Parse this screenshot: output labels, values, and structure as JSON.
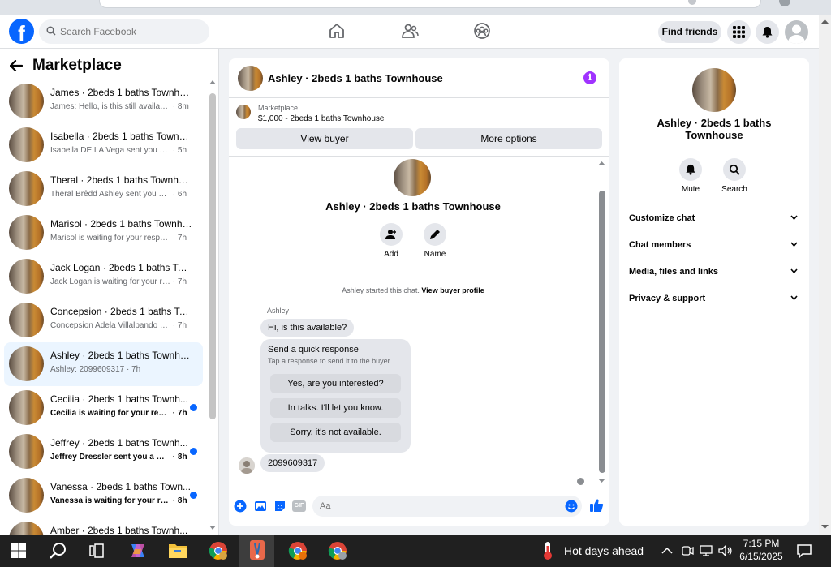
{
  "topbar": {
    "logo": "f",
    "search_placeholder": "Search Facebook",
    "find_friends": "Find friends"
  },
  "sidebar": {
    "title": "Marketplace",
    "conversations": [
      {
        "name": "James · 2beds 1 baths Townhouse",
        "preview": "James: Hello, is this still available?",
        "time": "· 8m",
        "unread": false,
        "active": false
      },
      {
        "name": "Isabella · 2beds 1 baths Townho...",
        "preview": "Isabella DE LA Vega sent you a me...",
        "time": "· 5h",
        "unread": false,
        "active": false
      },
      {
        "name": "Theral · 2beds 1 baths Townhouse",
        "preview": "Theral Brêdd Ashley sent you a me...",
        "time": "· 6h",
        "unread": false,
        "active": false
      },
      {
        "name": "Marisol · 2beds 1 baths Townho...",
        "preview": "Marisol is waiting for your respon...",
        "time": "· 7h",
        "unread": false,
        "active": false
      },
      {
        "name": "Jack Logan · 2beds 1 baths Tow...",
        "preview": "Jack Logan is waiting for your resp...",
        "time": "· 7h",
        "unread": false,
        "active": false
      },
      {
        "name": "Concepsion · 2beds 1 baths Tow...",
        "preview": "Concepsion Adela Villalpando sent...",
        "time": "· 7h",
        "unread": false,
        "active": false
      },
      {
        "name": "Ashley · 2beds 1 baths Townhou...",
        "preview": "Ashley: 2099609317",
        "time": "· 7h",
        "unread": false,
        "active": true
      },
      {
        "name": "Cecilia · 2beds 1 baths Townh...",
        "preview": "Cecilia is waiting for your resp...",
        "time": "· 7h",
        "unread": true,
        "active": false
      },
      {
        "name": "Jeffrey · 2beds 1 baths Townh...",
        "preview": "Jeffrey Dressler sent you a mes...",
        "time": "· 8h",
        "unread": true,
        "active": false
      },
      {
        "name": "Vanessa · 2beds 1 baths Town...",
        "preview": "Vanessa is waiting for your res...",
        "time": "· 8h",
        "unread": true,
        "active": false
      },
      {
        "name": "Amber · 2beds 1 baths Townh...",
        "preview": "",
        "time": "",
        "unread": false,
        "active": false
      }
    ]
  },
  "chat": {
    "title": "Ashley · 2beds 1 baths Townhouse",
    "info_icon": "i",
    "listing_source": "Marketplace",
    "listing_price": "$1,000 - 2beds 1 baths Townhouse",
    "view_buyer": "View buyer",
    "more_options": "More options",
    "convo_title": "Ashley · 2beds 1 baths Townhouse",
    "add_label": "Add",
    "name_label": "Name",
    "system_msg": "Ashley started this chat.",
    "system_link": "View buyer profile",
    "sender": "Ashley",
    "msg1": "Hi, is this available?",
    "quick_title": "Send a quick response",
    "quick_sub": "Tap a response to send it to the buyer.",
    "quick_replies": [
      "Yes, are you interested?",
      "In talks. I'll let you know.",
      "Sorry, it's not available."
    ],
    "msg2": "2099609317",
    "composer_placeholder": "Aa",
    "gif_label": "GIF"
  },
  "right_panel": {
    "title": "Ashley · 2beds 1 baths Townhouse",
    "mute": "Mute",
    "search": "Search",
    "sections": [
      "Customize chat",
      "Chat members",
      "Media, files and links",
      "Privacy & support"
    ]
  },
  "taskbar": {
    "weather": "Hot days ahead",
    "time": "7:15 PM",
    "date": "6/15/2025"
  },
  "colors": {
    "brand": "#0866ff",
    "info": "#a033ff",
    "unread_dot": "#0866ff"
  }
}
